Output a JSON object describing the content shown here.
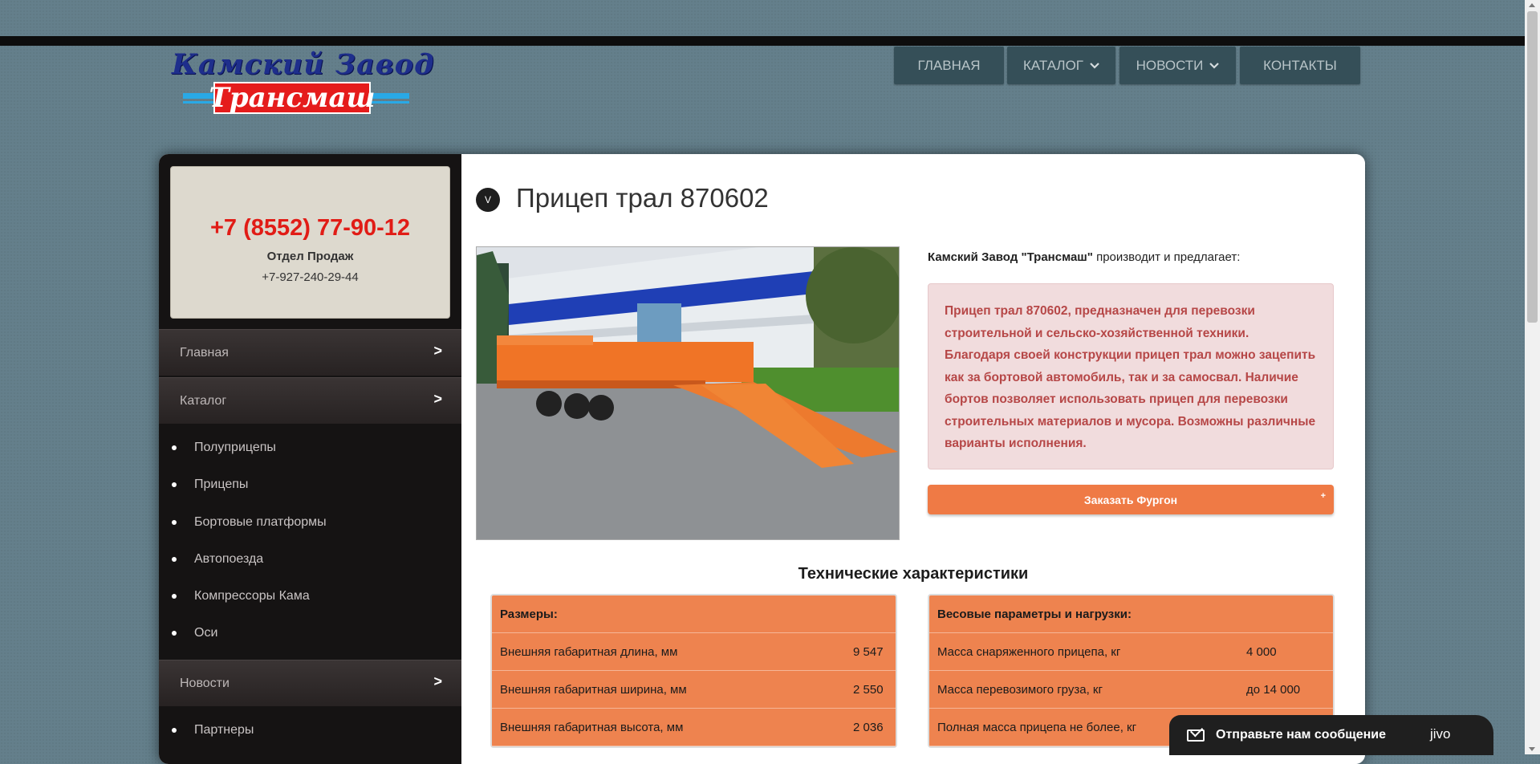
{
  "logo": {
    "top_text": "Камский  Завод",
    "box_text": "Трансмаш"
  },
  "nav": [
    {
      "label": "ГЛАВНАЯ",
      "chevron": false
    },
    {
      "label": "КАТАЛОГ",
      "chevron": true
    },
    {
      "label": "НОВОСТИ",
      "chevron": true
    },
    {
      "label": "КОНТАКТЫ",
      "chevron": false
    }
  ],
  "sidebar": {
    "phone": "+7 (8552) 77-90-12",
    "department": "Отдел Продаж",
    "phone_alt": "+7-927-240-29-44",
    "menu": [
      {
        "label": "Главная",
        "arrow": ">"
      },
      {
        "label": "Каталог",
        "arrow": ">"
      },
      {
        "label": "Новости",
        "arrow": ">"
      }
    ],
    "catalog_items": [
      "Полуприцепы",
      "Прицепы",
      "Бортовые платформы",
      "Автопоезда",
      "Компрессоры Кама",
      "Оси"
    ],
    "news_items": [
      "Партнеры"
    ]
  },
  "content": {
    "badge": "V",
    "title": "Прицеп трал 870602",
    "intro_company": "Камский Завод \"Трансмаш\"",
    "intro_rest": " производит и предлагает:",
    "description": "Прицеп трал 870602, предназначен для перевозки строительной и сельско-хозяйственной техники. Благодаря своей конструкции прицеп трал можно зацепить как за бортовой автомобиль, так и за самосвал. Наличие бортов позволяет использовать прицеп для перевозки строительных материалов и мусора. Возможны различные варианты исполнения.",
    "order_button": "Заказать Фургон",
    "order_plus": "+",
    "tech_title": "Технические характеристики",
    "dimensions": {
      "header": "Размеры:",
      "rows": [
        {
          "label": "Внешняя габаритная длина, мм",
          "value": "9 547"
        },
        {
          "label": "Внешняя габаритная ширина, мм",
          "value": "2 550"
        },
        {
          "label": "Внешняя габаритная высота, мм",
          "value": "2 036"
        }
      ]
    },
    "weights": {
      "header": "Весовые параметры и нагрузки:",
      "rows": [
        {
          "label": "Масса снаряженного прицепа, кг",
          "value": "4 000"
        },
        {
          "label": "Масса перевозимого груза, кг",
          "value": "до 14 000"
        },
        {
          "label": "Полная масса прицепа не более, кг",
          "value": ""
        }
      ]
    }
  },
  "chat": {
    "label": "Отправьте нам сообщение",
    "brand": "jivo"
  },
  "colors": {
    "accent": "#ef7a45",
    "phone": "#e11c16",
    "nav_bg": "#354f58",
    "description_text": "#b64747"
  }
}
